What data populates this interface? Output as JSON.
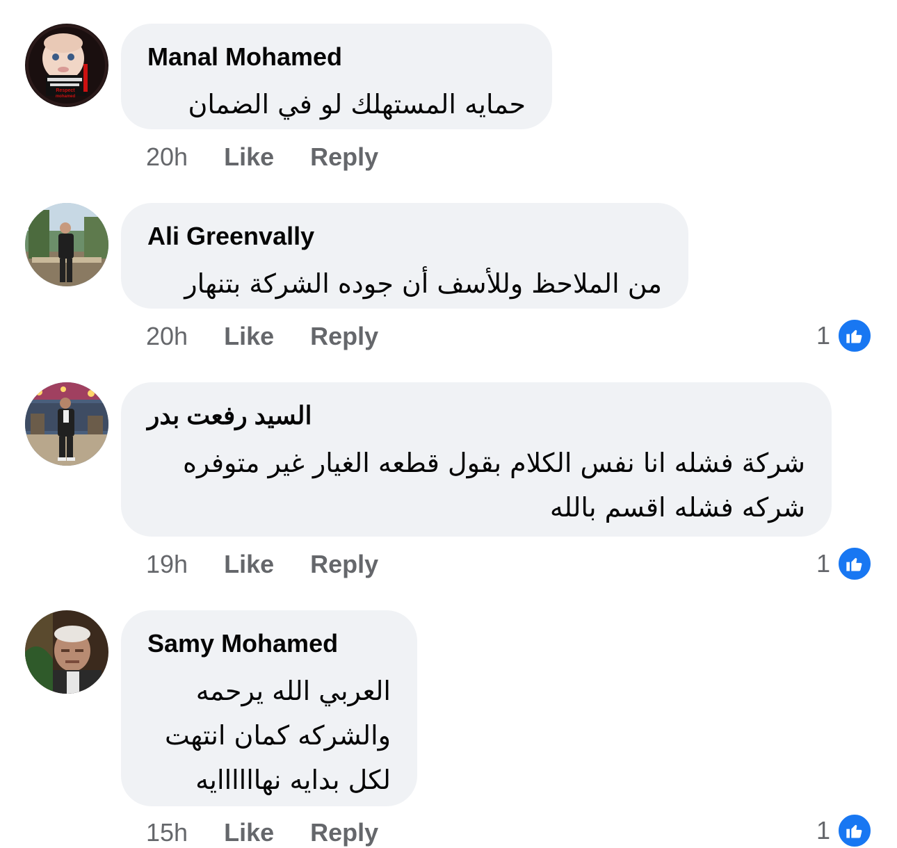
{
  "comments": [
    {
      "author": "Manal Mohamed",
      "text_lines": [
        "حمايه المستهلك  لو في الضمان"
      ],
      "time": "20h",
      "like_label": "Like",
      "reply_label": "Reply",
      "reaction_count": null,
      "avatar_icon": "baby-photo-avatar",
      "avatar_text": "Respect mohamed"
    },
    {
      "author": "Ali Greenvally",
      "text_lines": [
        "من الملاحظ وللأسف أن جوده الشركة بتنهار"
      ],
      "time": "20h",
      "like_label": "Like",
      "reply_label": "Reply",
      "reaction_count": "1",
      "avatar_icon": "man-outdoor-avatar"
    },
    {
      "author": "السيد رفعت بدر",
      "text_lines": [
        "شركة فشله انا نفس الكلام بقول قطعه الغيار غير متوفره",
        "شركه فشله اقسم بالله"
      ],
      "time": "19h",
      "like_label": "Like",
      "reply_label": "Reply",
      "reaction_count": "1",
      "avatar_icon": "man-party-avatar"
    },
    {
      "author": "Samy Mohamed",
      "text_lines": [
        "العربي الله يرحمه",
        "والشركه كمان انتهت",
        "لكل بدايه نهاااااايه"
      ],
      "time": "15h",
      "like_label": "Like",
      "reply_label": "Reply",
      "reaction_count": "1",
      "avatar_icon": "older-man-avatar"
    }
  ],
  "colors": {
    "bubble": "#f0f2f5",
    "meta_text": "#65676b",
    "like_badge": "#1877f2",
    "text": "#050505"
  }
}
